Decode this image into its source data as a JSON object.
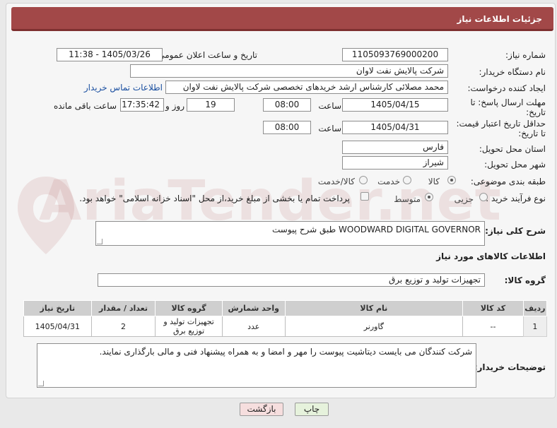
{
  "header": {
    "title": "جزئیات اطلاعات نیاز"
  },
  "fields": {
    "need_number_label": "شماره نیاز:",
    "need_number": "1105093769000200",
    "announce_label": "تاریخ و ساعت اعلان عمومی:",
    "announce_value": "1405/03/26 - 11:38",
    "buyer_org_label": "نام دستگاه خریدار:",
    "buyer_org": "شرکت پالایش نفت لاوان",
    "creator_label": "ایجاد کننده درخواست:",
    "creator": "محمد مصلائی کارشناس ارشد خریدهای تخصصی شرکت پالایش نفت لاوان",
    "contact_link": "اطلاعات تماس خریدار",
    "deadline_label_1": "مهلت ارسال پاسخ: تا",
    "deadline_label_2": "تاریخ:",
    "deadline_date": "1405/04/15",
    "time_label": "ساعت",
    "deadline_time": "08:00",
    "days_value": "19",
    "days_label": "روز و",
    "remaining_time": "17:35:42",
    "remaining_label": "ساعت باقی مانده",
    "price_label_1": "حداقل تاریخ اعتبار قیمت:",
    "price_label_2": "تا تاریخ:",
    "price_date": "1405/04/31",
    "price_time_label": "ساعت",
    "price_time": "08:00",
    "province_label": "استان محل تحویل:",
    "province": "فارس",
    "city_label": "شهر محل تحویل:",
    "city": "شیراز",
    "category_label": "طبقه بندی موضوعی:",
    "category_options": [
      "کالا",
      "خدمت",
      "کالا/خدمت"
    ],
    "process_label": "نوع فرآیند خرید :",
    "process_options": [
      "جزیی",
      "متوسط"
    ],
    "payment_note": "پرداخت تمام یا بخشی از مبلغ خرید،از محل \"اسناد خزانه اسلامی\" خواهد بود.",
    "description_label": "شرح کلی نیاز:",
    "description": "WOODWARD DIGITAL GOVERNOR طبق شرح پیوست",
    "goods_info_title": "اطلاعات کالاهای مورد نیاز",
    "goods_group_label": "گروه کالا:",
    "goods_group": "تجهیزات تولید و توزیع برق",
    "buyer_notes_label": "توضیحات خریدار:",
    "buyer_notes": "شرکت کنندگان می بایست دیتاشیت پیوست را مهر و امضا و به همراه پیشنهاد فنی و مالی بارگذاری نمایند."
  },
  "table": {
    "headers": [
      "ردیف",
      "کد کالا",
      "نام کالا",
      "واحد شمارش",
      "گروه کالا",
      "تعداد / مقدار",
      "تاریخ نیاز"
    ],
    "rows": [
      [
        "1",
        "--",
        "گاورنر",
        "عدد",
        "تجهیزات تولید و توزیع برق",
        "2",
        "1405/04/31"
      ]
    ]
  },
  "buttons": {
    "print": "چاپ",
    "back": "بازگشت"
  },
  "watermark": "AriaTender.net",
  "colors": {
    "header": "#a24848",
    "link": "#1a4fa0"
  }
}
